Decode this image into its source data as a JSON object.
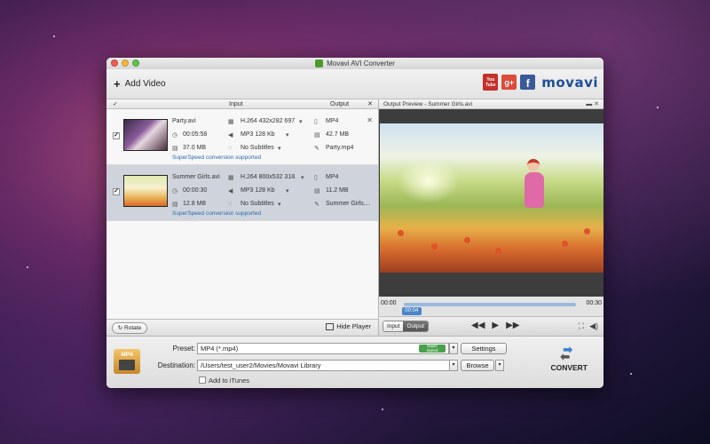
{
  "window": {
    "title": "Movavi AVI Converter"
  },
  "toolbar": {
    "add_video": "Add Video",
    "brand": {
      "youtube_top": "You",
      "youtube_bottom": "Tube",
      "gplus": "g+",
      "facebook": "f",
      "logo": "movavi"
    }
  },
  "list": {
    "headers": {
      "input": "Input",
      "output": "Output"
    },
    "rows": [
      {
        "name": "Party.avi",
        "duration": "00:05:58",
        "size": "37.0 MB",
        "video": "H.264 432x282 697",
        "audio": "MP3 128 Kb",
        "subtitles": "No Subtitles",
        "out_format": "MP4",
        "out_size": "42.7 MB",
        "out_name": "Party.mp4",
        "note": "SuperSpeed conversion supported",
        "checked": true,
        "selected": false
      },
      {
        "name": "Summer Girls.avi",
        "duration": "00:00:30",
        "size": "12.8 MB",
        "video": "H.264 800x532 318.",
        "audio": "MP3 128 Kb",
        "subtitles": "No Subtitles",
        "out_format": "MP4",
        "out_size": "11.2 MB",
        "out_name": "Summer Girls....",
        "note": "SuperSpeed conversion supported",
        "checked": true,
        "selected": true
      }
    ]
  },
  "left_footer": {
    "rotate": "Rotate",
    "hide_player": "Hide Player"
  },
  "preview": {
    "title": "Output Preview - Summer Girls.avi",
    "time_start": "00:00",
    "time_end": "00:30",
    "current_time": "00:04",
    "progress": 0.13,
    "tabs": [
      "Input",
      "Output"
    ],
    "active_tab": "Output"
  },
  "bottom": {
    "preset_label": "Preset:",
    "preset_value": "MP4 (*.mp4)",
    "superspeed_badge_top": "Super",
    "superspeed_badge_bottom": "Speed",
    "settings": "Settings",
    "destination_label": "Destination:",
    "destination_value": "/Users/test_user2/Movies/Movavi Library",
    "browse": "Browse",
    "itunes": "Add to iTunes",
    "convert": "CONVERT",
    "format_badge": "MP4"
  },
  "colors": {
    "accent": "#4a86c8",
    "selected_row": "#cfd4dc",
    "superspeed": "#49a14c"
  }
}
